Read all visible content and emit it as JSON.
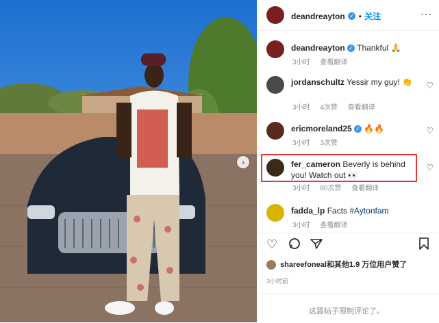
{
  "post": {
    "author": "deandreayton",
    "follow_label": "关注",
    "more": "···"
  },
  "comments": [
    {
      "user": "deandreayton",
      "text": "Thankful 🙏",
      "time": "3小时",
      "translate": "查看翻译",
      "likes": "",
      "verified": true,
      "avatar_color": "#7a1f1f"
    },
    {
      "user": "jordanschultz",
      "text": "Yessir my guy! 👏",
      "time": "3小时",
      "likes": "4次赞",
      "translate": "查看翻译",
      "verified": false,
      "avatar_color": "#4a4a4a"
    },
    {
      "user": "ericmoreland25",
      "text": "🔥🔥",
      "time": "3小时",
      "likes": "3次赞",
      "translate": "",
      "verified": true,
      "avatar_color": "#5a2a1e"
    },
    {
      "user": "fer_cameron",
      "text_line1": "Beverly is behind",
      "text_line2": "you! Watch out 👀",
      "time": "3小时",
      "likes": "80次赞",
      "translate": "查看翻译",
      "verified": false,
      "avatar_color": "#3b2a1a"
    },
    {
      "user": "fadda_lp",
      "text": "Facts",
      "hashtag": "#Aytonfam",
      "time": "3小时",
      "translate": "查看翻译",
      "likes": "",
      "verified": false,
      "avatar_color": "#d8b400"
    }
  ],
  "likes_summary": {
    "user": "shareefoneal",
    "rest": "和其他1.9 万位用户赞了"
  },
  "timestamp": "3小时前",
  "footer_text": "这篇帖子限制评论了。",
  "icons": {
    "heart": "heart-icon",
    "comment": "comment-icon",
    "share": "share-icon",
    "save": "bookmark-icon"
  }
}
